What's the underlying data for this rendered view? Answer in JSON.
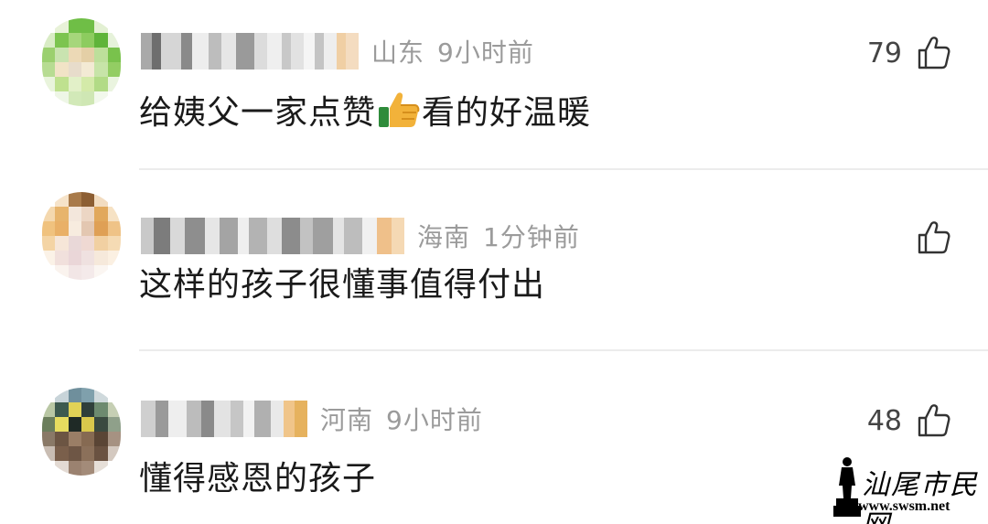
{
  "comments": [
    {
      "username": "",
      "location": "山东",
      "time": "9小时前",
      "text_before": "给姨父一家点赞",
      "emoji": "thumbs-up-emoji",
      "text_after": "看的好温暖",
      "likes": "79"
    },
    {
      "username": "",
      "location": "海南",
      "time": "1分钟前",
      "text": "这样的孩子很懂事值得付出",
      "likes": ""
    },
    {
      "username": "",
      "location": "河南",
      "time": "9小时前",
      "text": "懂得感恩的孩子",
      "likes": "48"
    }
  ],
  "watermark": {
    "name": "汕尾市民网",
    "url": "www.swsm.net"
  },
  "colors": {
    "meta": "#9b9b9b",
    "text": "#1a1a1a",
    "divider": "#ececec"
  }
}
